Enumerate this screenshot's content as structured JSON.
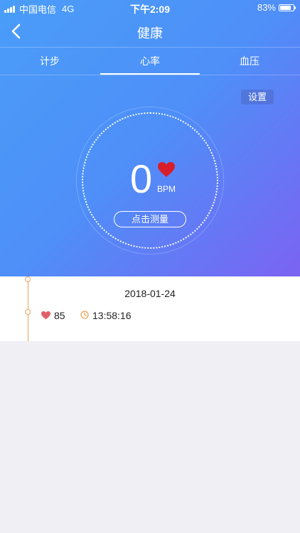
{
  "status_bar": {
    "carrier": "中国电信",
    "network": "4G",
    "time": "下午2:09",
    "battery_percent": "83%",
    "battery_level": 0.83
  },
  "nav": {
    "title": "健康",
    "back_icon": "chevron-left-icon"
  },
  "tabs": [
    {
      "label": "计步",
      "active": false
    },
    {
      "label": "心率",
      "active": true
    },
    {
      "label": "血压",
      "active": false
    }
  ],
  "heart_rate": {
    "settings_label": "设置",
    "value": "0",
    "unit": "BPM",
    "measure_label": "点击测量",
    "heart_color": "#d81e2a"
  },
  "records": {
    "date": "2018-01-24",
    "items": [
      {
        "heart_rate": "85",
        "time": "13:58:16"
      }
    ]
  },
  "colors": {
    "gradient_start": "#4a9df9",
    "gradient_end": "#7b63f2",
    "timeline": "#e8a25a",
    "small_heart": "#e0606a"
  }
}
